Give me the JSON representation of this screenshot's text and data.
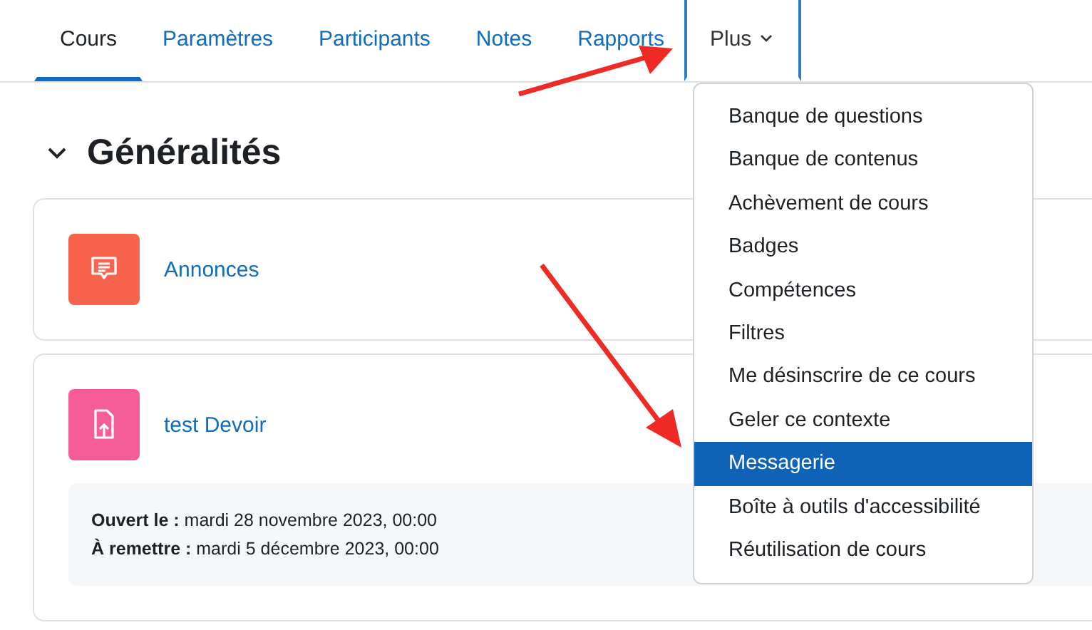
{
  "tabs": [
    {
      "label": "Cours",
      "selected": true
    },
    {
      "label": "Paramètres",
      "selected": false
    },
    {
      "label": "Participants",
      "selected": false
    },
    {
      "label": "Notes",
      "selected": false
    },
    {
      "label": "Rapports",
      "selected": false
    },
    {
      "label": "Plus",
      "selected": false,
      "expanded": true
    }
  ],
  "menu": [
    {
      "label": "Banque de questions",
      "selected": false
    },
    {
      "label": "Banque de contenus",
      "selected": false
    },
    {
      "label": "Achèvement de cours",
      "selected": false
    },
    {
      "label": "Badges",
      "selected": false
    },
    {
      "label": "Compétences",
      "selected": false
    },
    {
      "label": "Filtres",
      "selected": false
    },
    {
      "label": "Me désinscrire de ce cours",
      "selected": false
    },
    {
      "label": "Geler ce contexte",
      "selected": false
    },
    {
      "label": "Messagerie",
      "selected": true
    },
    {
      "label": "Boîte à outils d'accessibilité",
      "selected": false
    },
    {
      "label": "Réutilisation de cours",
      "selected": false
    }
  ],
  "section": {
    "title": "Généralités",
    "expanded": true
  },
  "activities": [
    {
      "kind": "forum",
      "name": "Annonces",
      "color": "#f7634d"
    },
    {
      "kind": "assign",
      "name": "test Devoir",
      "color": "#f65d98",
      "dates": [
        "**Ouvert le :** mardi 28 novembre 2023, 00:00",
        "**À remettre :** mardi 5 décembre 2023, 00:00"
      ]
    }
  ]
}
